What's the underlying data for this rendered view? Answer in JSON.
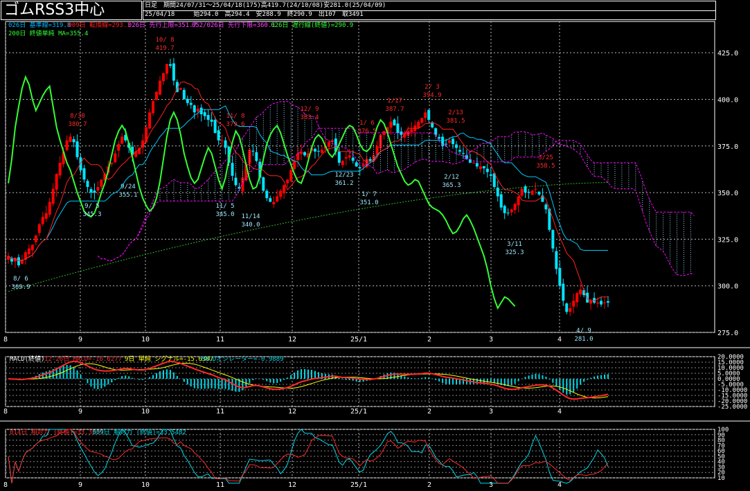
{
  "header": {
    "title": "ゴムRSS3中心",
    "period_row": "日足　期間24/07/31～25/04/18(175)高419.7(24/10/08)安281.0(25/04/09)",
    "ohlc_row": "25/04/18　　　始294.0　高294.4　安288.9　終290.9　出107　取3491"
  },
  "colors": {
    "bg": "#000000",
    "grid": "#ffffff",
    "up_candle": "#ff0000",
    "down_candle": "#00e5ff",
    "kijun": "#00c8ff",
    "tenkan": "#ff2020",
    "senkou_a": "#ff00ff",
    "senkou_b": "#ff00ff",
    "chikou": "#33ff33",
    "ma200": "#2eb82e",
    "macd": "#ff2a2a",
    "signal": "#ffff00",
    "osc": "#00d8e8",
    "rsi14": "#ff2a2a",
    "rsi9": "#00d8e8",
    "label_red": "#ff2a2a",
    "label_cyan": "#9fe8ff"
  },
  "chart_data": [
    {
      "type": "candlestick",
      "title": "ゴムRSS3中心",
      "legend": [
        {
          "text": "026日 基準線=319.8",
          "color": "#00b4ff"
        },
        {
          "text": "009日 転換線=293.1",
          "color": "#ff2020"
        },
        {
          "text": "026日 先行上限=351.7",
          "color": "#ff40ff"
        },
        {
          "text": "052/026日 先行下限=360.1",
          "color": "#ff40ff"
        },
        {
          "text": "026日 遅行線(終値)=290.9",
          "color": "#33ff33"
        },
        {
          "text": "200日 終値単純 MA=355.4",
          "color": "#33ff33"
        }
      ],
      "ylim": [
        275,
        431
      ],
      "yticks": [
        "425.0",
        "400.0",
        "375.0",
        "350.0",
        "325.0",
        "300.0",
        "275.0"
      ],
      "x_months": [
        "8",
        "9",
        "10",
        "11",
        "12",
        "25/1",
        "2",
        "3",
        "4"
      ],
      "candles_close": [
        316,
        313,
        315,
        311,
        314,
        318,
        320,
        322,
        327,
        333,
        337,
        339,
        345,
        352,
        360,
        366,
        372,
        378,
        380,
        377,
        369,
        362,
        357,
        353,
        350,
        350,
        353,
        357,
        360,
        364,
        366,
        371,
        376,
        380,
        378,
        374,
        370,
        372,
        374,
        378,
        385,
        393,
        399,
        404,
        410,
        414,
        419,
        418,
        410,
        404,
        406,
        400,
        398,
        397,
        393,
        395,
        392,
        391,
        389,
        388,
        382,
        378,
        378,
        374,
        366,
        359,
        354,
        352,
        358,
        365,
        373,
        372,
        367,
        358,
        351,
        347,
        345,
        345,
        348,
        351,
        354,
        357,
        362,
        367,
        371,
        372,
        370,
        371,
        374,
        372,
        372,
        373,
        375,
        377,
        378,
        372,
        366,
        367,
        369,
        370,
        367,
        364,
        363,
        365,
        368,
        367,
        370,
        375,
        381,
        383,
        385,
        388,
        386,
        382,
        381,
        382,
        383,
        384,
        386,
        388,
        390,
        393,
        389,
        385,
        381,
        379,
        375,
        376,
        378,
        376,
        374,
        372,
        371,
        368,
        366,
        366,
        364,
        364,
        363,
        361,
        359,
        353,
        348,
        342,
        339,
        339,
        341,
        344,
        348,
        352,
        350,
        350,
        351,
        352,
        349,
        345,
        341,
        330,
        320,
        309,
        300,
        292,
        286,
        288,
        292,
        296,
        298,
        295,
        291,
        292,
        291,
        291,
        290,
        291,
        291
      ],
      "highs_annotations": [
        {
          "date": "8/ 6",
          "value": 309.9
        },
        {
          "date": "8/30",
          "value": 380.7
        },
        {
          "date": "9/ 5",
          "value": 345.3
        },
        {
          "date": "9/24",
          "value": 355.1
        },
        {
          "date": "10/ 8",
          "value": 419.7
        },
        {
          "date": "11/ 8",
          "value": 379.6
        },
        {
          "date": "11/ 5",
          "value": 345.0
        },
        {
          "date": "11/14",
          "value": 340.0
        },
        {
          "date": "12/ 9",
          "value": 383.4
        },
        {
          "date": "12/23",
          "value": 361.2
        },
        {
          "date": "1/ 6",
          "value": 376.5
        },
        {
          "date": "1/ 7",
          "value": 351.0
        },
        {
          "date": "1/17",
          "value": 387.7
        },
        {
          "date": "2/ 3",
          "value": 394.9
        },
        {
          "date": "2/13",
          "value": 381.5
        },
        {
          "date": "2/12",
          "value": 365.3
        },
        {
          "date": "3/11",
          "value": 325.3
        },
        {
          "date": "3/25",
          "value": 358.5
        },
        {
          "date": "4/ 9",
          "value": 281.0
        }
      ],
      "chikou_close": [
        355,
        368,
        385,
        396,
        406,
        412,
        408,
        400,
        394,
        398,
        402,
        405,
        407,
        396,
        385,
        378,
        372,
        366,
        362,
        356,
        350,
        345,
        340,
        338,
        337,
        339,
        344,
        350,
        355,
        362,
        370,
        378,
        383,
        386,
        383,
        376,
        369,
        361,
        353,
        347,
        343,
        340,
        342,
        347,
        356,
        368,
        380,
        389,
        393,
        389,
        381,
        371,
        364,
        358,
        355,
        357,
        363,
        369,
        374,
        371,
        364,
        357,
        352,
        358,
        368,
        377,
        383,
        380,
        373,
        365,
        357,
        352,
        353,
        359,
        368,
        376,
        381,
        384,
        386,
        382,
        376,
        370,
        365,
        360,
        356,
        355,
        360,
        367,
        374,
        379,
        381,
        379,
        375,
        371,
        369,
        372,
        376,
        380,
        384,
        386,
        385,
        381,
        376,
        373,
        372,
        374,
        379,
        385,
        389,
        387,
        382,
        376,
        370,
        364,
        360,
        356,
        354,
        355,
        357,
        356,
        352,
        348,
        344,
        342,
        341,
        340,
        338,
        335,
        331,
        328,
        329,
        332,
        336,
        338,
        335,
        331,
        326,
        321,
        316,
        309,
        300,
        293,
        288,
        291,
        294,
        293,
        291,
        289
      ],
      "ma200_start": 297,
      "ma200_end": 355.4
    },
    {
      "type": "line",
      "title": "MACD",
      "legend": [
        {
          "text": "MACD(終値)",
          "color": "#ffffff"
        },
        {
          "text": "12-26日 MACD=-16.6277",
          "color": "#ff2a2a"
        },
        {
          "text": "9日 単純 シグナル=-15.6387",
          "color": "#ffff00"
        },
        {
          "text": "MACDオシレーター=-0.9889",
          "color": "#00d8e8"
        }
      ],
      "ylim": [
        -25,
        20
      ],
      "yticks": [
        "20.0000",
        "15.0000",
        "10.0000",
        "5.0000",
        "0.0000",
        "-5.0000",
        "-10.0000",
        "-15.0000",
        "-20.0000",
        "-25.0000"
      ],
      "macd_end": -16.6277,
      "signal_end": -15.6387,
      "osc_end": -0.9889
    },
    {
      "type": "line",
      "title": "相対力",
      "legend": [
        {
          "text": "014日 相対力 (終値)=33.3539",
          "color": "#ff2a2a"
        },
        {
          "text": "009日 相対力 (終値)=33.5482",
          "color": "#00d8e8"
        }
      ],
      "ylim": [
        10,
        100
      ],
      "yticks": [
        "100",
        "90",
        "80",
        "70",
        "60",
        "50",
        "40",
        "30",
        "20",
        "10"
      ],
      "rsi14_end": 33.3539,
      "rsi9_end": 33.5482
    }
  ]
}
